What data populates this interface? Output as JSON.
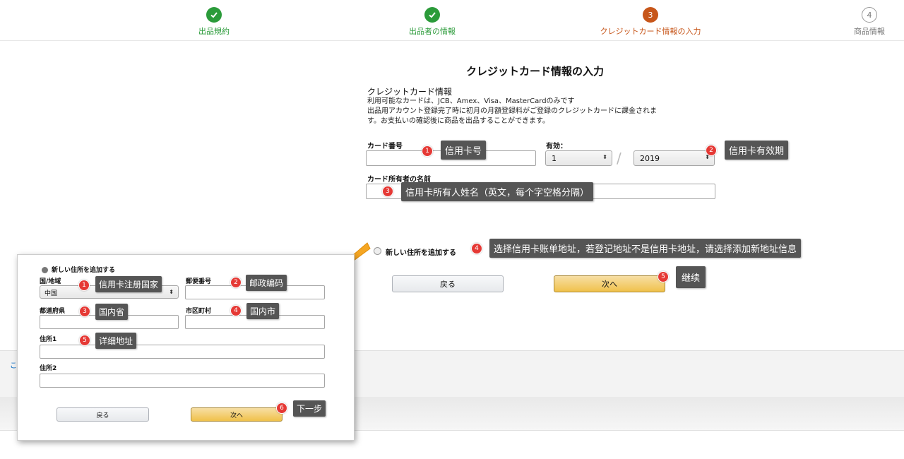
{
  "stepper": {
    "steps": [
      {
        "label": "出品規約",
        "state": "done"
      },
      {
        "label": "出品者の情報",
        "state": "done"
      },
      {
        "label": "クレジットカード情報の入力",
        "state": "current",
        "number": "3"
      },
      {
        "label": "商品情報",
        "state": "todo",
        "number": "4"
      }
    ]
  },
  "form": {
    "title": "クレジットカード情報の入力",
    "section_heading": "クレジットカード情報",
    "info_lines": [
      "利用可能なカードは、JCB、Amex、Visa、MasterCardのみです",
      "出品用アカウント登録完了時に初月の月額登録料がご登録のクレジットカードに課金されま",
      "す。お支払いの確認後に商品を出品することができます。"
    ],
    "card_number_label": "カード番号",
    "expiry_label": "有効：",
    "expiry_month": "1",
    "expiry_year": "2019",
    "holder_label": "カード所有者の名前",
    "add_address_label": "新しい住所を追加する",
    "back_button": "戻る",
    "next_button": "次へ"
  },
  "annotations": {
    "card_number": {
      "num": "1",
      "text": "信用卡号"
    },
    "expiry": {
      "num": "2",
      "text": "信用卡有效期"
    },
    "holder": {
      "num": "3",
      "text": "信用卡所有人姓名（英文，每个字空格分隔）"
    },
    "address": {
      "num": "4",
      "text": "选择信用卡账单地址，若登记地址不是信用卡地址，请选择添加新地址信息"
    },
    "continue": {
      "num": "5",
      "text": "继续"
    }
  },
  "panel": {
    "add_address_label": "新しい住所を追加する",
    "country_label": "国/地域",
    "country_value": "中国",
    "postal_label": "郵便番号",
    "prefecture_label": "都道府県",
    "city_label": "市区町村",
    "address1_label": "住所1",
    "address2_label": "住所2",
    "back_button": "戻る",
    "next_button": "次へ",
    "annotations": {
      "country": {
        "num": "1",
        "text": "信用卡注册国家"
      },
      "postal": {
        "num": "2",
        "text": "邮政编码"
      },
      "prefecture": {
        "num": "3",
        "text": "国内省"
      },
      "city": {
        "num": "4",
        "text": "国内市"
      },
      "address1": {
        "num": "5",
        "text": "详细地址"
      },
      "next": {
        "num": "6",
        "text": "下一步"
      }
    }
  },
  "footer": {
    "link_text": "こ"
  },
  "colors": {
    "done": "#2b9b3a",
    "current": "#c7561a",
    "badge": "#e53935",
    "tip": "#555555",
    "primary_button": "#f0c14b",
    "arrow": "#f5a623"
  }
}
